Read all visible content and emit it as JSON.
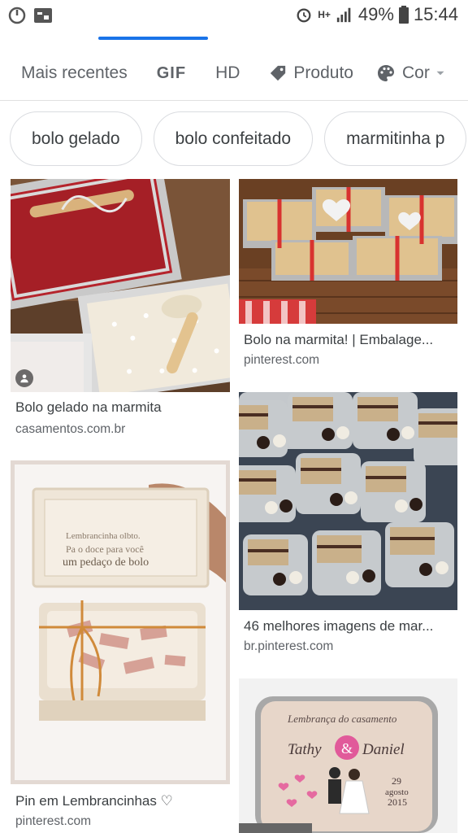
{
  "status_bar": {
    "battery": "49%",
    "time": "15:44",
    "network": "H+"
  },
  "tabs": [
    {
      "label": "Mais recentes",
      "icon": ""
    },
    {
      "label": "GIF",
      "icon": ""
    },
    {
      "label": "HD",
      "icon": ""
    },
    {
      "label": "Produto",
      "icon": "tag-icon"
    },
    {
      "label": "Cor",
      "icon": "palette-icon"
    }
  ],
  "chips": [
    "bolo gelado",
    "bolo confeitado",
    "marmitinha p"
  ],
  "results": [
    {
      "title": "Bolo gelado na marmita",
      "domain": "casamentos.com.br"
    },
    {
      "title": "Bolo na marmita! | Embalage...",
      "domain": "pinterest.com"
    },
    {
      "title": "Pin em Lembrancinhas ♡",
      "domain": "pinterest.com"
    },
    {
      "title": "46 melhores imagens de mar...",
      "domain": "br.pinterest.com"
    },
    {
      "title": "",
      "domain": ""
    }
  ],
  "image_text": {
    "card3_lid_1": "Lembrancinha olbto.",
    "card3_lid_2": "Pa o doce para você",
    "card3_lid_3": "um pedaço de bolo",
    "card5_header": "Lembrança do casamento",
    "card5_name1": "Tathy",
    "card5_amp": "&",
    "card5_name2": "Daniel",
    "card5_date_1": "29",
    "card5_date_2": "agosto",
    "card5_date_3": "2015"
  }
}
